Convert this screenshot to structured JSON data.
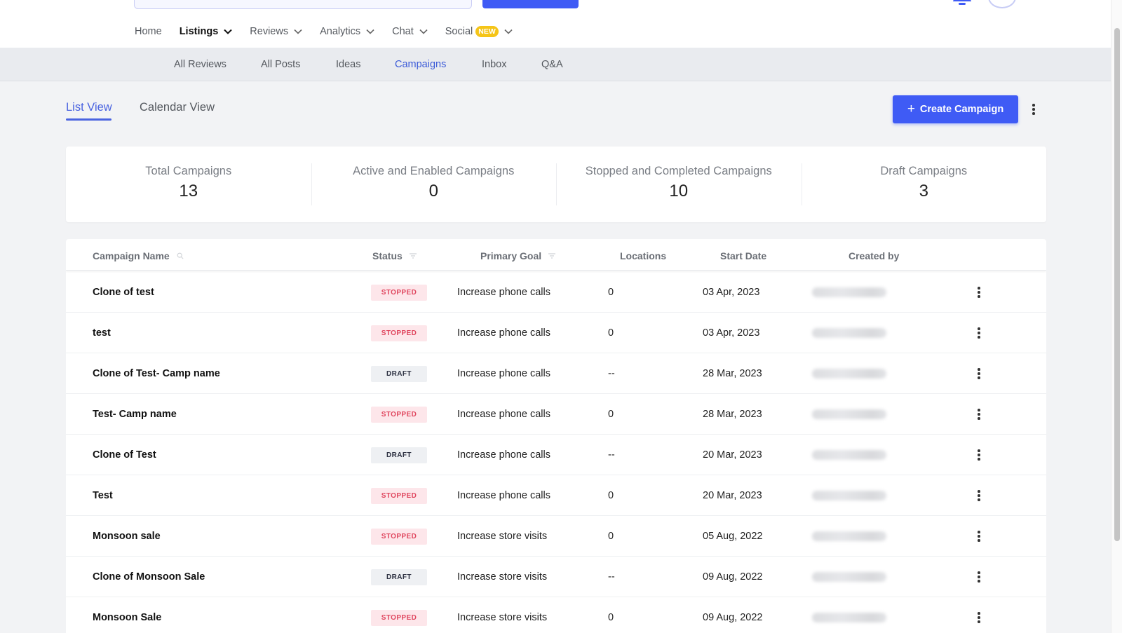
{
  "colors": {
    "accent": "#3f5bf5",
    "stopped_text": "#e0475f",
    "stopped_bg": "#fde6ea",
    "draft_bg": "#eef0f3",
    "new_badge": "#f5c518"
  },
  "main_nav": {
    "home": "Home",
    "listings": "Listings",
    "reviews": "Reviews",
    "analytics": "Analytics",
    "chat": "Chat",
    "social": "Social",
    "social_badge": "NEW"
  },
  "sub_nav": {
    "all_reviews": "All Reviews",
    "all_posts": "All Posts",
    "ideas": "Ideas",
    "campaigns": "Campaigns",
    "inbox": "Inbox",
    "qa": "Q&A"
  },
  "view_tabs": {
    "list": "List View",
    "calendar": "Calendar View"
  },
  "create_button": {
    "icon": "+",
    "label": "Create Campaign"
  },
  "stats": {
    "total": {
      "label": "Total Campaigns",
      "value": "13"
    },
    "active": {
      "label": "Active and Enabled Campaigns",
      "value": "0"
    },
    "stopped": {
      "label": "Stopped and Completed Campaigns",
      "value": "10"
    },
    "draft": {
      "label": "Draft Campaigns",
      "value": "3"
    }
  },
  "table": {
    "headers": {
      "name": "Campaign Name",
      "status": "Status",
      "goal": "Primary Goal",
      "locations": "Locations",
      "start_date": "Start Date",
      "created_by": "Created by"
    },
    "rows": [
      {
        "name": "Clone of test",
        "status": "STOPPED",
        "goal": "Increase phone calls",
        "locations": "0",
        "date": "03 Apr, 2023"
      },
      {
        "name": "test",
        "status": "STOPPED",
        "goal": "Increase phone calls",
        "locations": "0",
        "date": "03 Apr, 2023"
      },
      {
        "name": "Clone of Test- Camp name",
        "status": "DRAFT",
        "goal": "Increase phone calls",
        "locations": "--",
        "date": "28 Mar, 2023"
      },
      {
        "name": "Test- Camp name",
        "status": "STOPPED",
        "goal": "Increase phone calls",
        "locations": "0",
        "date": "28 Mar, 2023"
      },
      {
        "name": "Clone of Test",
        "status": "DRAFT",
        "goal": "Increase phone calls",
        "locations": "--",
        "date": "20 Mar, 2023"
      },
      {
        "name": "Test",
        "status": "STOPPED",
        "goal": "Increase phone calls",
        "locations": "0",
        "date": "20 Mar, 2023"
      },
      {
        "name": "Monsoon sale",
        "status": "STOPPED",
        "goal": "Increase store visits",
        "locations": "0",
        "date": "05 Aug, 2022"
      },
      {
        "name": "Clone of Monsoon Sale",
        "status": "DRAFT",
        "goal": "Increase store visits",
        "locations": "--",
        "date": "09 Aug, 2022"
      },
      {
        "name": "Monsoon Sale",
        "status": "STOPPED",
        "goal": "Increase store visits",
        "locations": "0",
        "date": "09 Aug, 2022"
      }
    ]
  }
}
